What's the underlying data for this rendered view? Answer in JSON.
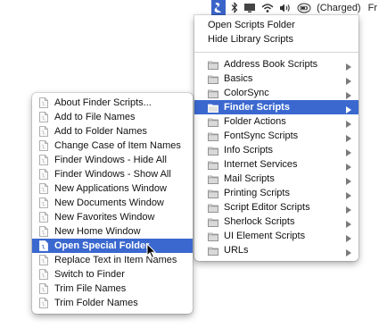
{
  "menubar": {
    "status_label": "(Charged)",
    "trailing_label": "Fr",
    "icons": [
      "script-menu-icon",
      "bluetooth-icon",
      "display-icon",
      "airport-icon",
      "volume-icon",
      "battery-icon"
    ]
  },
  "script_menu": {
    "header_items": [
      "Open Scripts Folder",
      "Hide Library Scripts"
    ],
    "folders": [
      {
        "label": "Address Book Scripts"
      },
      {
        "label": "Basics"
      },
      {
        "label": "ColorSync"
      },
      {
        "label": "Finder Scripts",
        "highlighted": true
      },
      {
        "label": "Folder Actions"
      },
      {
        "label": "FontSync Scripts"
      },
      {
        "label": "Info Scripts"
      },
      {
        "label": "Internet Services"
      },
      {
        "label": "Mail Scripts"
      },
      {
        "label": "Printing Scripts"
      },
      {
        "label": "Script Editor Scripts"
      },
      {
        "label": "Sherlock Scripts"
      },
      {
        "label": "UI Element Scripts"
      },
      {
        "label": "URLs"
      }
    ]
  },
  "finder_submenu": {
    "items": [
      {
        "label": "About Finder Scripts..."
      },
      {
        "label": "Add to File Names"
      },
      {
        "label": "Add to Folder Names"
      },
      {
        "label": "Change Case of Item Names"
      },
      {
        "label": "Finder Windows - Hide All"
      },
      {
        "label": "Finder Windows - Show All"
      },
      {
        "label": "New Applications Window"
      },
      {
        "label": "New Documents Window"
      },
      {
        "label": "New Favorites Window"
      },
      {
        "label": "New Home Window"
      },
      {
        "label": "Open Special Folder",
        "highlighted": true
      },
      {
        "label": "Replace Text in Item Names"
      },
      {
        "label": "Switch to Finder"
      },
      {
        "label": "Trim File Names"
      },
      {
        "label": "Trim Folder Names"
      }
    ]
  },
  "colors": {
    "highlight": "#3b68cf",
    "menu_bg": "#ffffff"
  }
}
